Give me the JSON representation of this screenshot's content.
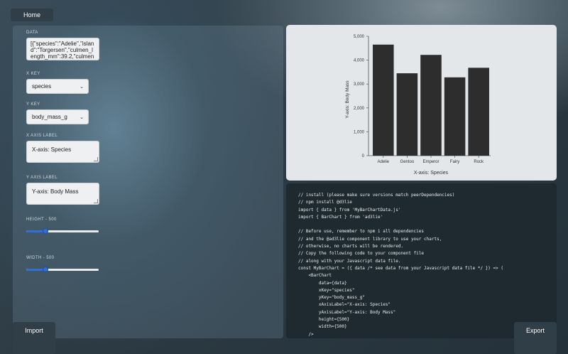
{
  "header": {
    "home_label": "Home"
  },
  "footer": {
    "import_label": "Import",
    "export_label": "Export"
  },
  "form": {
    "data_label": "DATA",
    "data_value": "[{\"species\":\"Adelie\",\"island\":\"Torgersen\",\"culmen_length_mm\":39.2,\"culmen_",
    "xkey_label": "X KEY",
    "xkey_value": "species",
    "ykey_label": "Y KEY",
    "ykey_value": "body_mass_g",
    "xaxis_label_title": "X AXIS LABEL",
    "xaxis_label_value": "X-axis: Species",
    "yaxis_label_title": "Y AXIS LABEL",
    "yaxis_label_value": "Y-axis: Body Mass",
    "height_label": "HEIGHT - 500",
    "height_value": 500,
    "width_label": "WIDTH - 500",
    "width_value": 500,
    "slider_fraction": 0.26
  },
  "chart_data": {
    "type": "bar",
    "categories": [
      "Adelie",
      "Gentoo",
      "Emperor",
      "Fairy",
      "Rock"
    ],
    "values": [
      4650,
      3450,
      4220,
      3280,
      3680
    ],
    "xlabel": "X-axis: Species",
    "ylabel": "Y-axis: Body Mass",
    "ylim": [
      0,
      5000
    ],
    "yticks": [
      "0",
      "1,000",
      "2,000",
      "3,000",
      "4,000",
      "5,000"
    ],
    "bar_color": "#2d2d2d",
    "grid": false
  },
  "code": {
    "lines": [
      "// install (please make sure versions match peerDependencies)",
      "// npm install @d3lie",
      "import { data } from 'MyBarChartData.js'",
      "import { BarChart } from 'ad3lie'",
      "",
      "// Before use, remember to npm i all dependencies",
      "// and the @ad3lie component library to use your charts,",
      "// otherwise, no charts will be rendered.",
      "// Copy the following code to your component file",
      "// along with your Javascript data file.",
      "const MyBarChart = ({ data /* see data from your Javascript data file */ }) => (",
      "    <BarChart",
      "        data={data}",
      "        xKey=\"species\"",
      "        yKey=\"body_mass_g\"",
      "        xAxisLabel=\"X-axis: Species\"",
      "        yAxisLabel=\"Y-axis: Body Mass\"",
      "        height={500}",
      "        width={500}",
      "    />"
    ]
  },
  "colors": {
    "accent": "#2f6fd6",
    "panel_dark": "#1e2a30"
  }
}
